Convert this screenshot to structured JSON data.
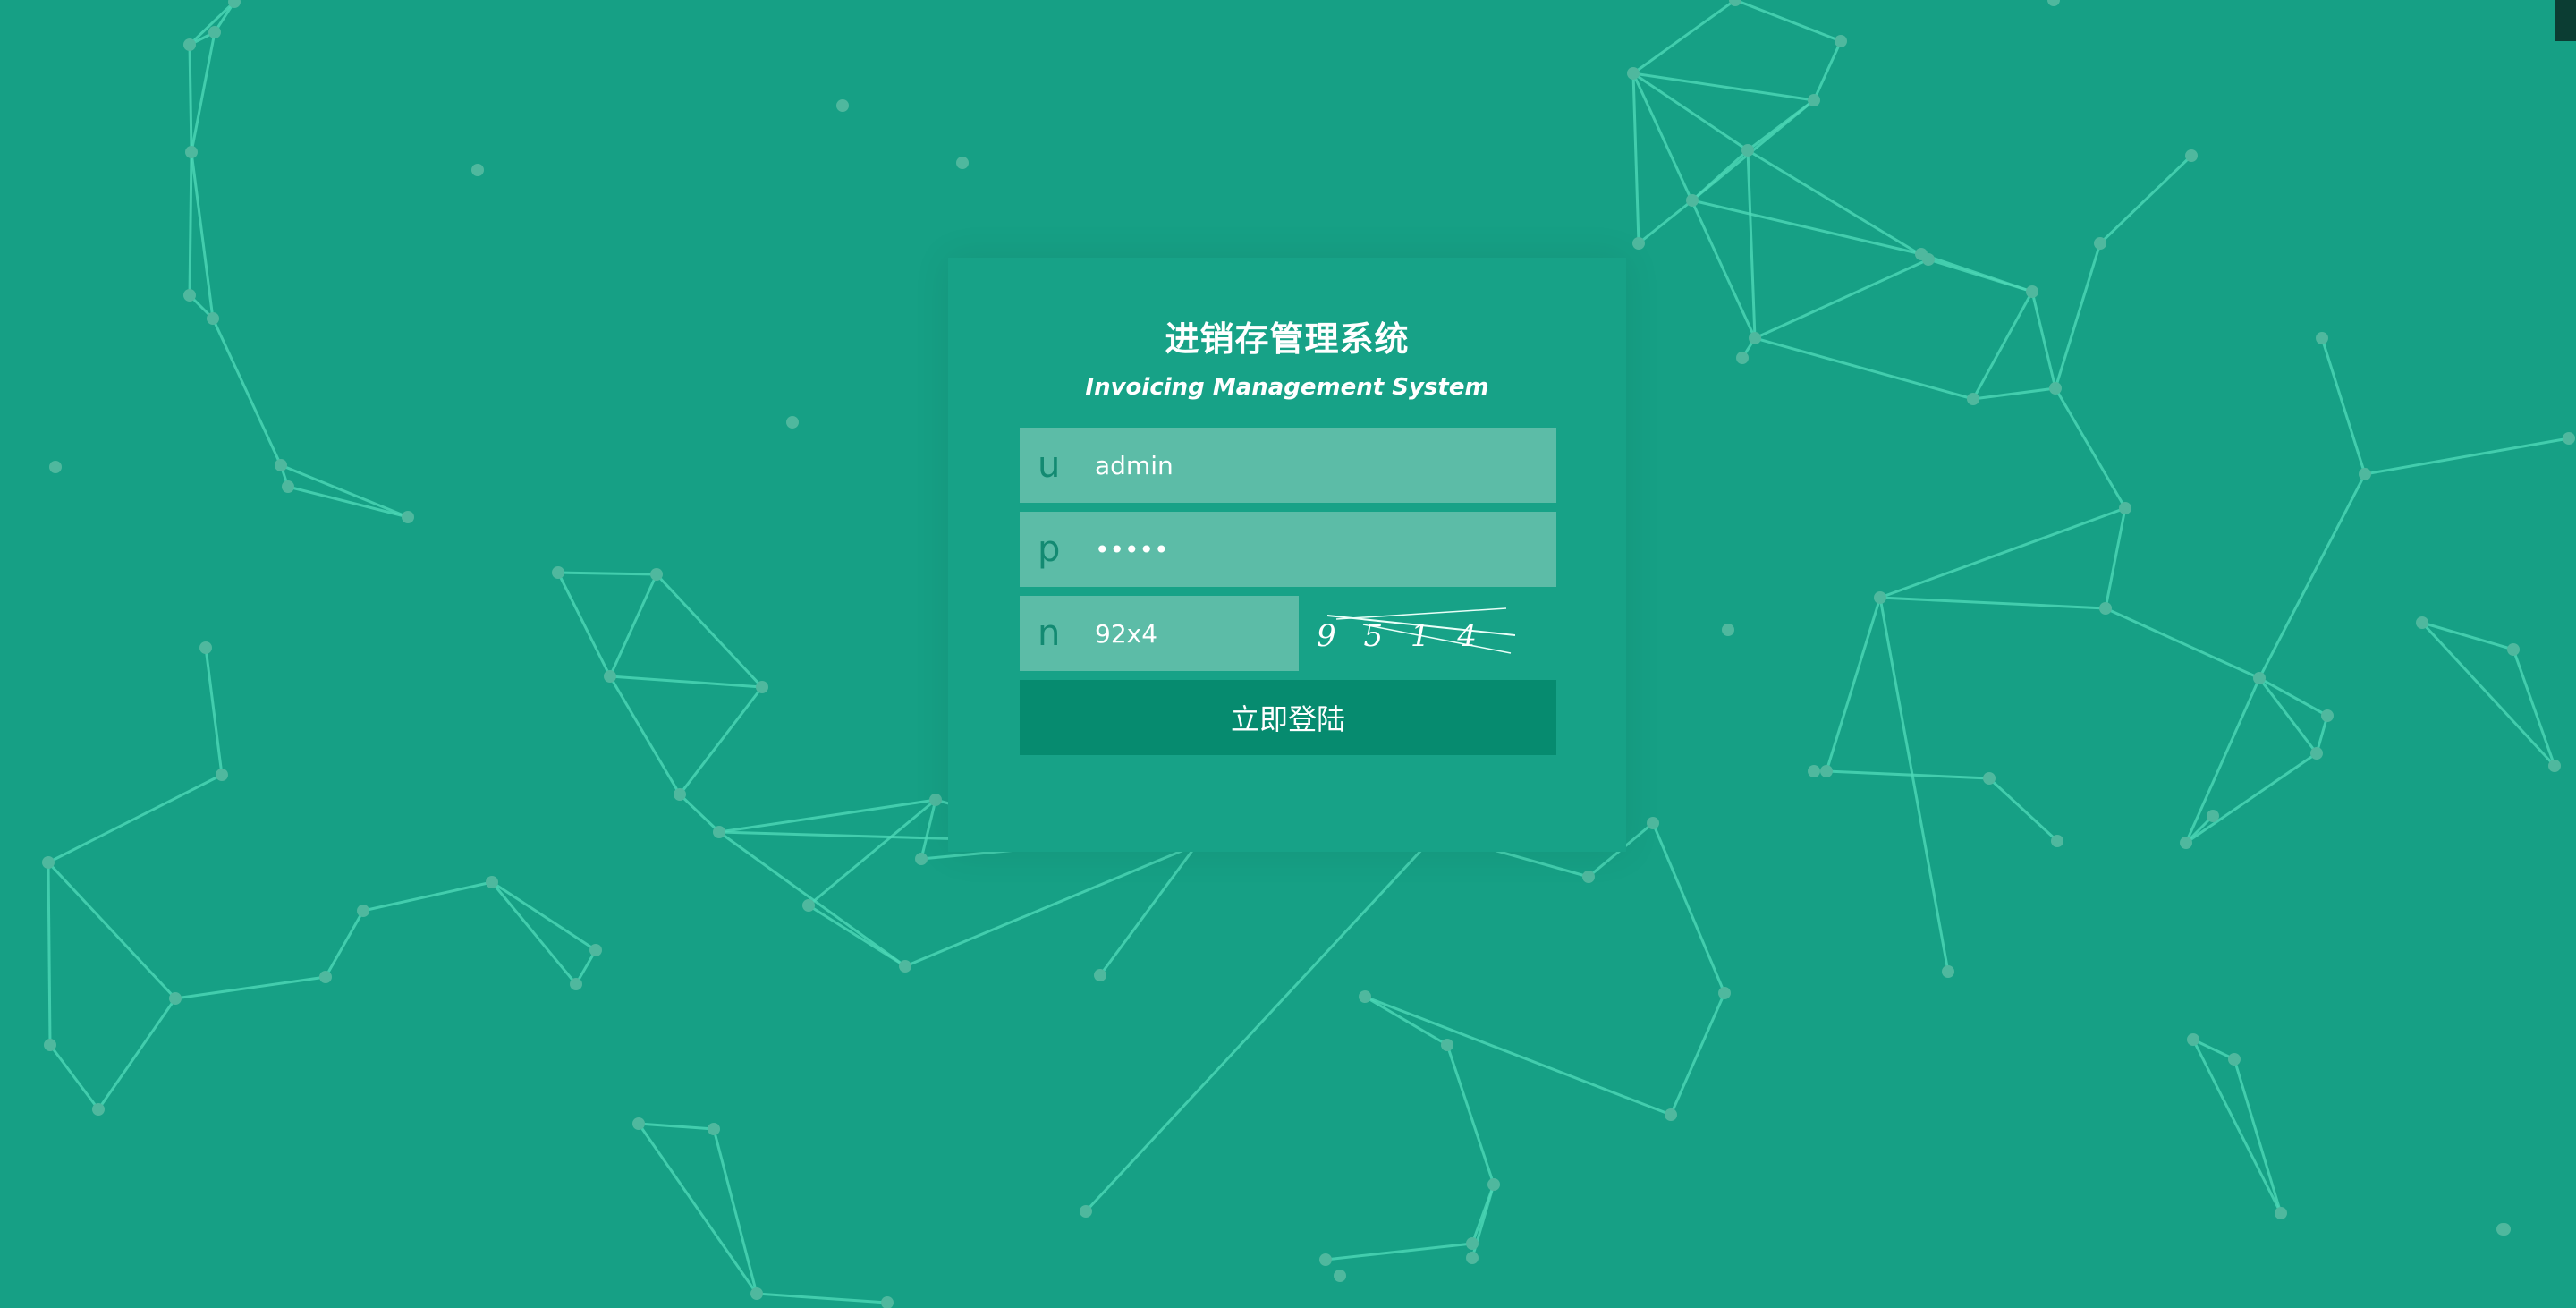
{
  "app": {
    "title": "进销存管理系统",
    "subtitle": "Invoicing Management System"
  },
  "form": {
    "username": {
      "prefix": "u",
      "value": "admin"
    },
    "password": {
      "prefix": "p",
      "value": "•••••"
    },
    "captcha": {
      "prefix": "n",
      "value": "92x4",
      "image_text": "9 5 1 4"
    },
    "submit_label": "立即登陆"
  },
  "colors": {
    "background": "#16a085",
    "card": "#17a287",
    "field": "#5cbca7",
    "button": "#068b6f",
    "network_line": "#4dd8b6",
    "network_node": "#4fb89e"
  }
}
